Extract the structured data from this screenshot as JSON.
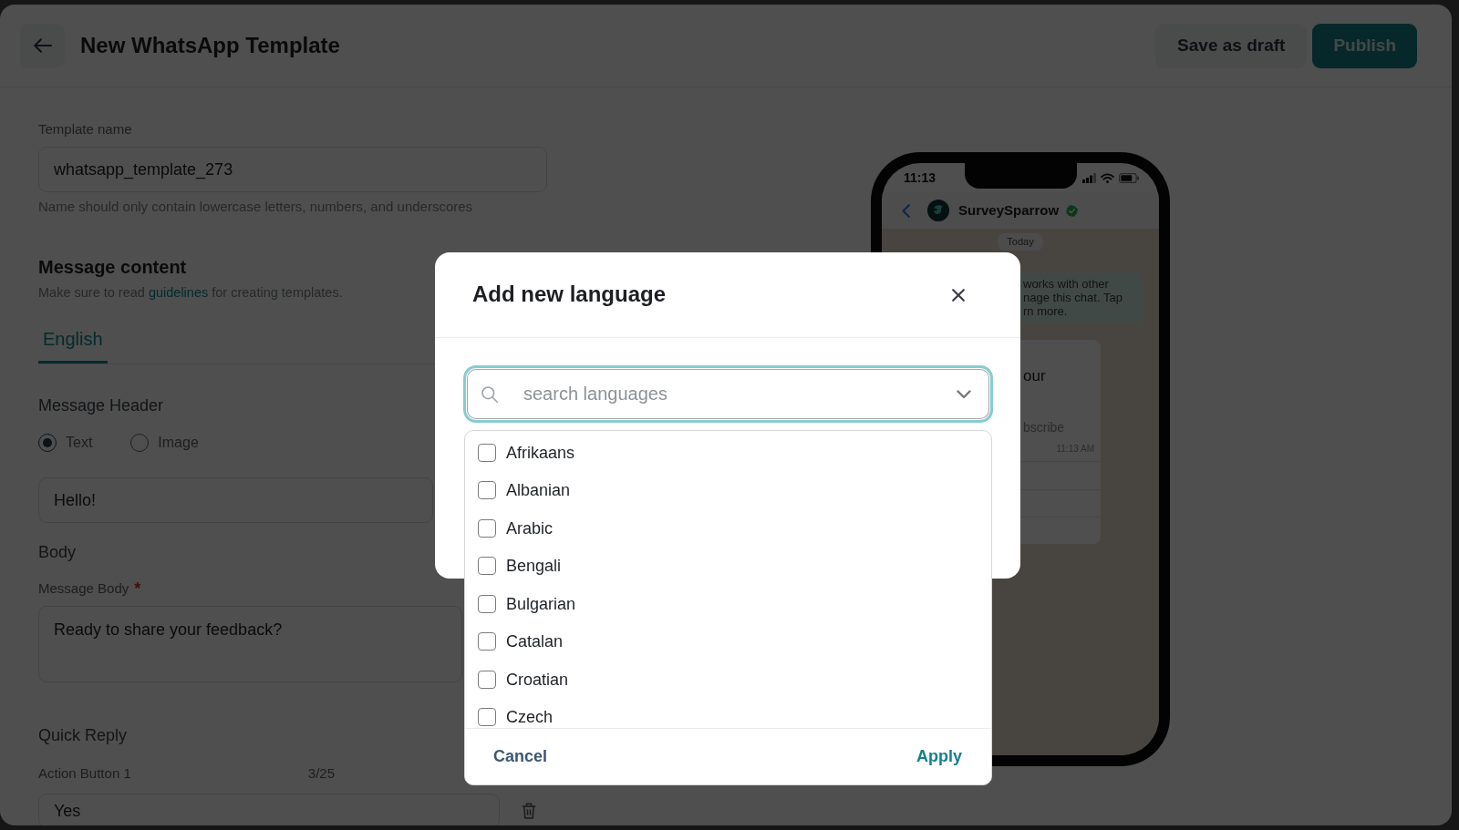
{
  "header": {
    "title": "New WhatsApp Template",
    "buttons": [
      {
        "label": "Save as draft",
        "kind": "secondary"
      },
      {
        "label": "Publish",
        "kind": "primary"
      }
    ]
  },
  "template_name": {
    "label": "Template name",
    "value": "whatsapp_template_273",
    "hint": "Name should only contain lowercase letters, numbers, and underscores"
  },
  "message_content": {
    "title": "Message content",
    "note_before": "Make sure to read",
    "note_link": "guidelines",
    "note_after": "for creating templates."
  },
  "tabs": [
    {
      "label": "English",
      "selected": true
    }
  ],
  "message_header": {
    "label": "Message Header",
    "options": [
      {
        "label": "Text",
        "selected": true
      },
      {
        "label": "Image",
        "selected": false
      }
    ],
    "value": "Hello!"
  },
  "body": {
    "title": "Body",
    "label": "Message Body",
    "required_mark": "*",
    "value": "Ready to share your feedback?"
  },
  "quick_reply": {
    "title": "Quick Reply",
    "buttons": [
      {
        "label": "Action Button 1",
        "count": "3/25",
        "value": "Yes"
      }
    ]
  },
  "preview": {
    "time": "11:13",
    "contact": "SurveySparrow",
    "verified": true,
    "date_chip": "Today",
    "system_message_lines": [
      "works with other",
      "nage this chat. Tap",
      "rn more."
    ],
    "message": {
      "text": "our",
      "footer": "bscribe",
      "time": "11:13 AM"
    }
  },
  "dialog": {
    "title": "Add new language",
    "search": {
      "placeholder": "search languages"
    },
    "options": [
      {
        "label": "Afrikaans",
        "checked": false
      },
      {
        "label": "Albanian",
        "checked": false
      },
      {
        "label": "Arabic",
        "checked": false
      },
      {
        "label": "Bengali",
        "checked": false
      },
      {
        "label": "Bulgarian",
        "checked": false
      },
      {
        "label": "Catalan",
        "checked": false
      },
      {
        "label": "Croatian",
        "checked": false
      },
      {
        "label": "Czech",
        "checked": false
      }
    ],
    "buttons": [
      {
        "label": "Cancel",
        "kind": "cancel"
      },
      {
        "label": "Apply",
        "kind": "apply"
      }
    ]
  }
}
